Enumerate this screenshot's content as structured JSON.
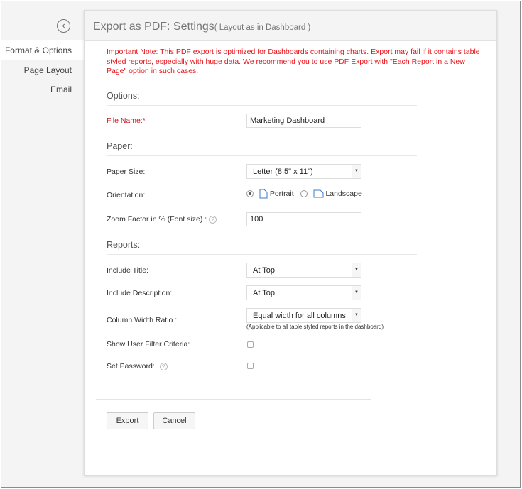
{
  "sidebar": {
    "items": [
      {
        "label": "Format & Options",
        "active": true
      },
      {
        "label": "Page Layout"
      },
      {
        "label": "Email"
      }
    ]
  },
  "header": {
    "title": "Export as PDF: Settings",
    "subtitle": "( Layout as in Dashboard )"
  },
  "note": "Important Note: This PDF export is optimized for Dashboards containing charts. Export may fail if it contains table styled reports, especially with huge data. We recommend you to use PDF Export with \"Each Report in a New Page\" option in such cases.",
  "options": {
    "heading": "Options:",
    "file_name_label": "File Name:",
    "required_mark": "*",
    "file_name_value": "Marketing Dashboard"
  },
  "paper": {
    "heading": "Paper:",
    "size_label": "Paper Size:",
    "size_value": "Letter (8.5\" x 11\")",
    "orientation_label": "Orientation:",
    "portrait": "Portrait",
    "landscape": "Landscape",
    "selected": "Portrait",
    "zoom_label": "Zoom Factor in % (Font size) :",
    "zoom_value": "100"
  },
  "reports": {
    "heading": "Reports:",
    "title_label": "Include Title:",
    "title_value": "At Top",
    "desc_label": "Include Description:",
    "desc_value": "At Top",
    "col_label": "Column Width Ratio :",
    "col_value": "Equal width for all columns",
    "col_note": "(Applicable to all table styled reports in the dashboard)",
    "filter_label": "Show User Filter Criteria:",
    "password_label": "Set Password:"
  },
  "buttons": {
    "export": "Export",
    "cancel": "Cancel"
  },
  "icons": {
    "help": "?",
    "arrow": "▼",
    "back": "‹"
  }
}
